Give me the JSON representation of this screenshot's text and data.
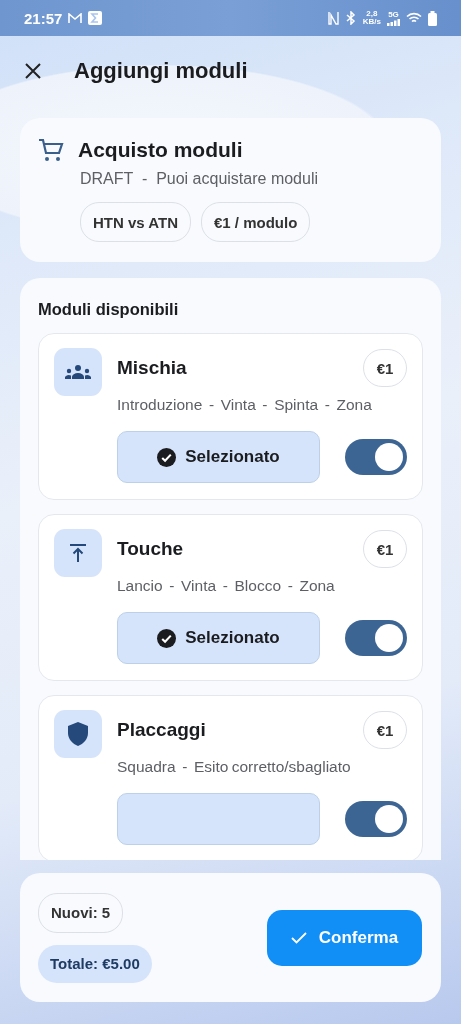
{
  "status_bar": {
    "time": "21:57",
    "network_speed": [
      "2,8",
      "KB/s"
    ],
    "network_type": "5G"
  },
  "header": {
    "title": "Aggiungi moduli"
  },
  "purchase": {
    "title": "Acquisto moduli",
    "subtitle": "DRAFT  -  Puoi acquistare moduli",
    "chips": [
      "HTN vs ATN",
      "€1 / modulo"
    ]
  },
  "modules_section": {
    "title": "Moduli disponibili",
    "modules": [
      {
        "kind": "group",
        "name": "Mischia",
        "price": "€1",
        "description": "Introduzione  -  Vinta  -  Spinta  -  Zona",
        "button_label": "Selezionato",
        "selected": true,
        "on": true
      },
      {
        "kind": "upload",
        "name": "Touche",
        "price": "€1",
        "description": "Lancio  -  Vinta  -  Blocco  -  Zona",
        "button_label": "Selezionato",
        "selected": true,
        "on": true
      },
      {
        "kind": "shield",
        "name": "Placcaggi",
        "price": "€1",
        "description": "Squadra  -  Esito corretto/sbagliato",
        "selected": true,
        "on": true
      }
    ]
  },
  "footer": {
    "new_count": "Nuovi: 5",
    "total": "Totale: €5.00",
    "confirm": "Conferma"
  }
}
